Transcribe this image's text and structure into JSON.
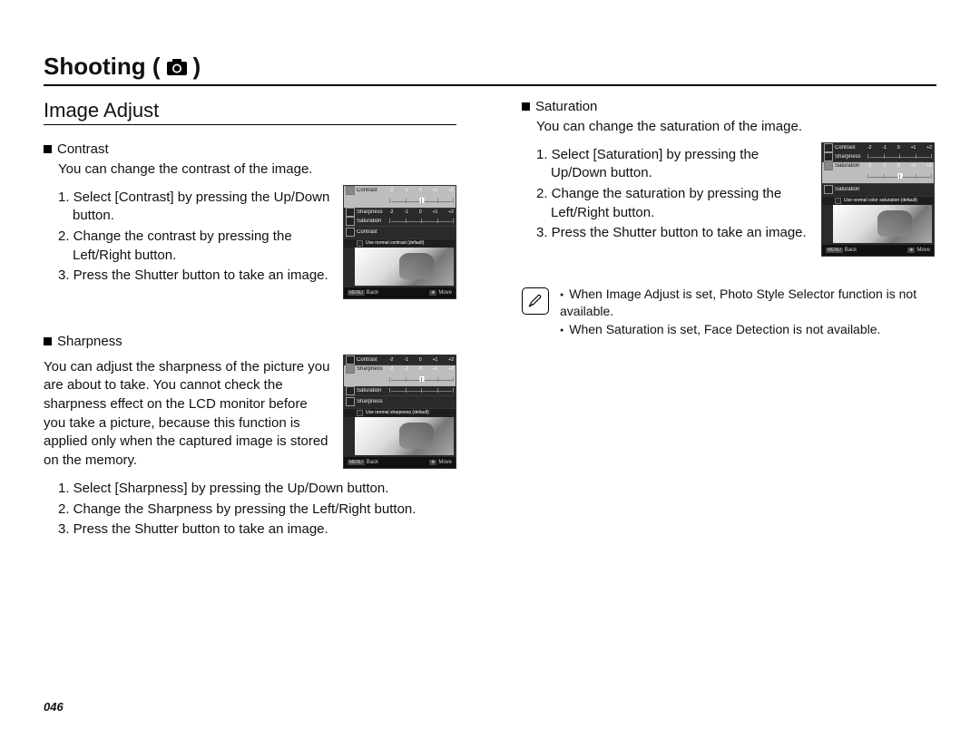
{
  "chapter": {
    "title_prefix": "Shooting (",
    "title_suffix": ")"
  },
  "section_title": "Image Adjust",
  "page_number": "046",
  "scale_labels": [
    "-2",
    "-1",
    "0",
    "+1",
    "+2"
  ],
  "lcd_menu_labels": {
    "contrast": "Contrast",
    "sharpness": "Sharpness",
    "saturation": "Saturation"
  },
  "lcd_back": "Back",
  "lcd_move": "Move",
  "lcd_back_tag": "MENU",
  "contrast": {
    "heading": "Contrast",
    "desc": "You can change the contrast of the image.",
    "steps": {
      "s1": "1. Select [Contrast] by pressing the Up/Down button.",
      "s2": "2. Change the contrast by pressing the Left/Right button.",
      "s3": "3. Press the Shutter button to take an image."
    },
    "lcd_selected": "Contrast",
    "lcd_hint": "Use normal contrast (default)"
  },
  "sharpness": {
    "heading": "Sharpness",
    "desc": "You can adjust the sharpness of the picture you are about to take. You cannot check the sharpness effect on the LCD monitor before you take a picture, because this function is applied only when the captured image is stored on the memory.",
    "steps": {
      "s1": "1. Select [Sharpness] by pressing the Up/Down button.",
      "s2": "2. Change the Sharpness by pressing the Left/Right button.",
      "s3": "3. Press the Shutter button to take an image."
    },
    "lcd_selected": "Sharpness",
    "lcd_hint": "Use normal sharpness (default)"
  },
  "saturation": {
    "heading": "Saturation",
    "desc": "You can change the saturation of the image.",
    "steps": {
      "s1": "1. Select [Saturation] by pressing the Up/Down button.",
      "s2": "2. Change the saturation by pressing the Left/Right button.",
      "s3": "3. Press the Shutter button to take an image."
    },
    "lcd_selected": "Saturation",
    "lcd_hint": "Use normal color saturation (default)"
  },
  "note": {
    "n1": "When Image Adjust  is set, Photo Style Selector function is not available.",
    "n2": "When Saturation is set, Face Detection is not available."
  }
}
